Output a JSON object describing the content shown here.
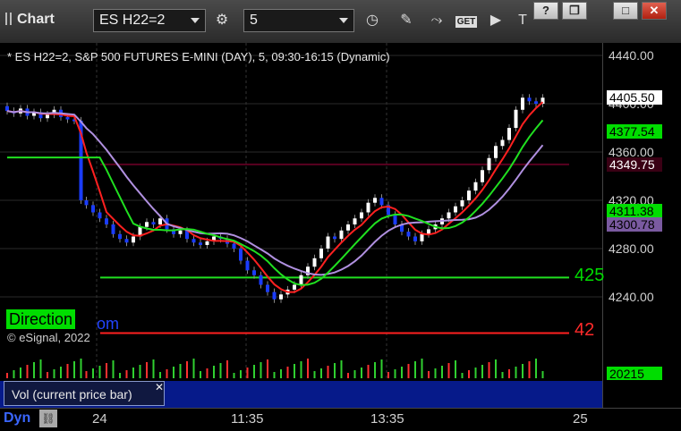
{
  "window": {
    "title": "Chart",
    "symbol": "ES H22=2",
    "interval": "5",
    "controls": [
      "?",
      "❐",
      "□",
      "✕"
    ]
  },
  "chart": {
    "caption": "* ES H22=2, S&P 500 FUTURES E-MINI (DAY), 5, 09:30-16:15 (Dynamic)",
    "direction_label": "Direction",
    "direction_tail": "om",
    "copyright": "© eSignal, 2022",
    "level_green_label": "425",
    "level_red_label": "42",
    "y_ticks": [
      "4440.00",
      "4400.00",
      "4360.00",
      "4320.00",
      "4280.00",
      "4240.00"
    ],
    "price_tags": [
      {
        "text": "4405.50",
        "bg": "#ffffff",
        "fg": "#000000"
      },
      {
        "text": "4377.54",
        "bg": "#00dd00",
        "fg": "#000000"
      },
      {
        "text": "4349.75",
        "bg": "#3a0014",
        "fg": "#ffffff"
      },
      {
        "text": "4311.38",
        "bg": "#00dd00",
        "fg": "#000000"
      },
      {
        "text": "4300.78",
        "bg": "#7a5aa0",
        "fg": "#000000"
      }
    ],
    "volume_tag": {
      "text": "20215",
      "bg": "#00dd00",
      "fg": "#000000"
    }
  },
  "volume": {
    "label": "Vol (current price bar)",
    "close": "✕"
  },
  "xaxis": {
    "ticks": [
      "24",
      "11:35",
      "13:35",
      "25"
    ],
    "dyn_label": "Dyn"
  },
  "colors": {
    "up": "#ffffff",
    "down": "#1a3cff",
    "ma_red": "#ff2020",
    "ma_green": "#20e020",
    "ma_purple": "#b090e0"
  }
}
